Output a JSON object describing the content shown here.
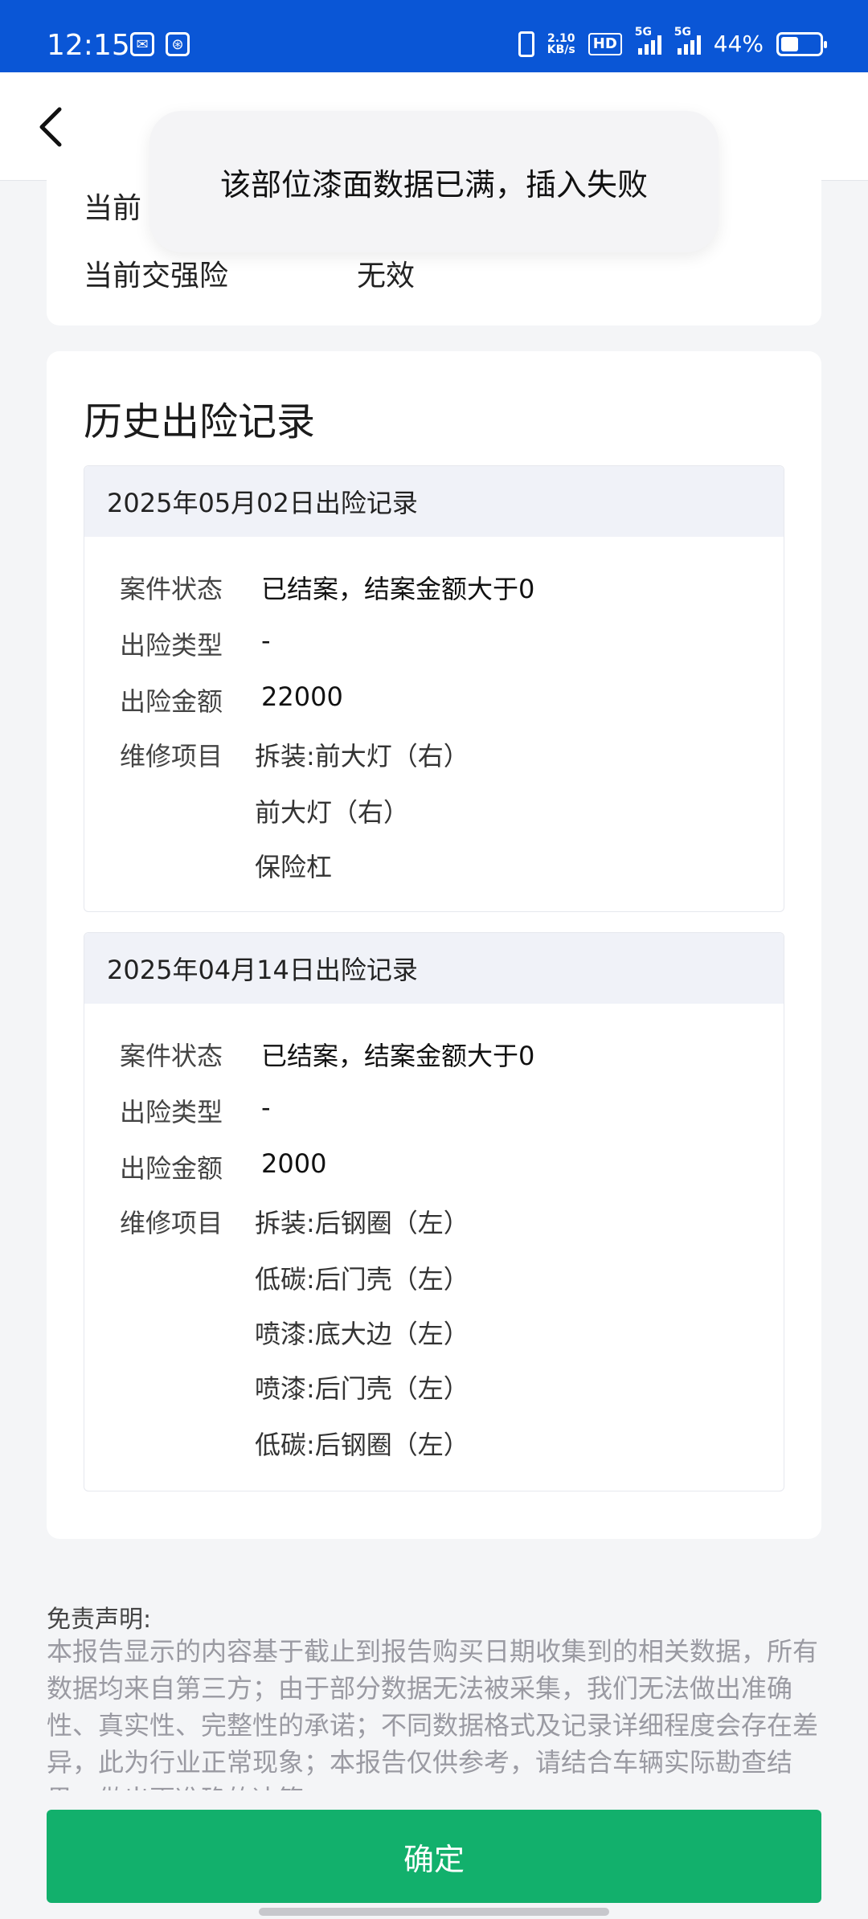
{
  "status_bar": {
    "time": "12:15",
    "app_icons": [
      "wechat-icon",
      "app-badge-icon"
    ],
    "net_speed": "2.10\nKB/s",
    "hd": "HD",
    "sim1": "5G",
    "sim2": "5G",
    "battery": "44%"
  },
  "header": {
    "back_icon": "chevron-left-icon"
  },
  "toast": {
    "message": "该部位漆面数据已满，插入失败"
  },
  "current": {
    "row1_label": "当前",
    "row2_label": "当前交强险",
    "row2_value": "无效"
  },
  "history": {
    "title": "历史出险记录",
    "records": [
      {
        "header": "2025年05月02日出险记录",
        "status_label": "案件状态",
        "status": "已结案，结案金额大于0",
        "type_label": "出险类型",
        "type": "-",
        "amount_label": "出险金额",
        "amount": "22000",
        "items_label": "维修项目",
        "items": [
          "拆装:前大灯（右）",
          "前大灯（右）",
          "保险杠"
        ]
      },
      {
        "header": "2025年04月14日出险记录",
        "status_label": "案件状态",
        "status": "已结案，结案金额大于0",
        "type_label": "出险类型",
        "type": "-",
        "amount_label": "出险金额",
        "amount": "2000",
        "items_label": "维修项目",
        "items": [
          "拆装:后钢圈（左）",
          "低碳:后门壳（左）",
          "喷漆:底大边（左）",
          "喷漆:后门壳（左）",
          "低碳:后钢圈（左）"
        ]
      }
    ]
  },
  "disclaimer": {
    "title": "免责声明:",
    "body": "本报告显示的内容基于截止到报告购买日期收集到的相关数据，所有数据均来自第三方；由于部分数据无法被采集，我们无法做出准确性、真实性、完整性的承诺；不同数据格式及记录详细程度会存在差异，此为行业正常现象；本报告仅供参考，请结合车辆实际勘查结果，做出更准确的决策。"
  },
  "confirm_label": "确定",
  "colors": {
    "status_bar": "#0a56d6",
    "confirm": "#12b06c",
    "record_head": "#f0f2f8"
  }
}
